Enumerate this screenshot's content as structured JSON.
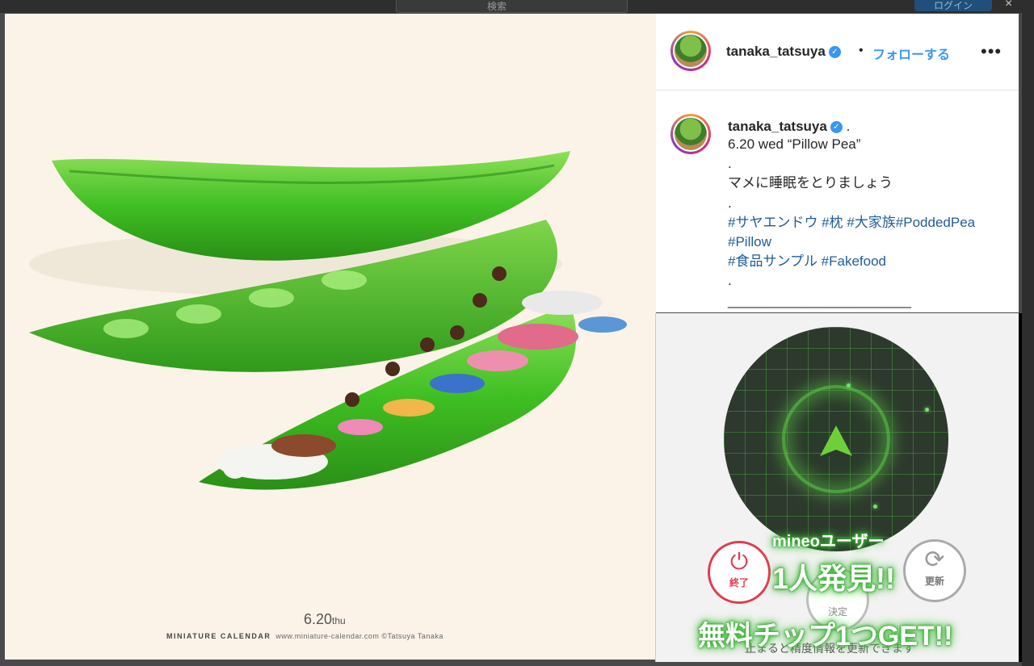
{
  "header": {
    "search_placeholder": "検索",
    "login_label": "ログイン",
    "close_icon": "×"
  },
  "photo": {
    "date": "6.20",
    "day": "thu",
    "credit_brand": "MINIATURE CALENDAR",
    "credit_text": "www.miniature-calendar.com ©Tatsuya Tanaka"
  },
  "post": {
    "username": "tanaka_tatsuya",
    "verified_icon": "verified-badge-icon",
    "separator": "•",
    "follow_label": "フォローする",
    "more_label": "•••",
    "caption": {
      "username": "tanaka_tatsuya",
      "lead": ".",
      "lines": [
        "6.20 wed “Pillow Pea”",
        ".",
        "マメに睡眠をとりましょう",
        "."
      ],
      "hashtags1": "#サヤエンドウ #枕 #大家族#PoddedPea",
      "hashtags2": "#Pillow",
      "hashtags3": "#食品サンプル #Fakefood",
      "trail": ".",
      "divider": "________________________"
    }
  },
  "overlay_app": {
    "end_label": "終了",
    "decide_label": "決定",
    "refresh_label": "更新",
    "found_line1": "mineoユーザー",
    "found_line2": "1人発見!!",
    "found_line3": "無料チップ1つGET!!",
    "hint": "止まると精度情報を更新できます",
    "accent_color": "#6fcf3a",
    "end_color": "#e23c4e"
  }
}
